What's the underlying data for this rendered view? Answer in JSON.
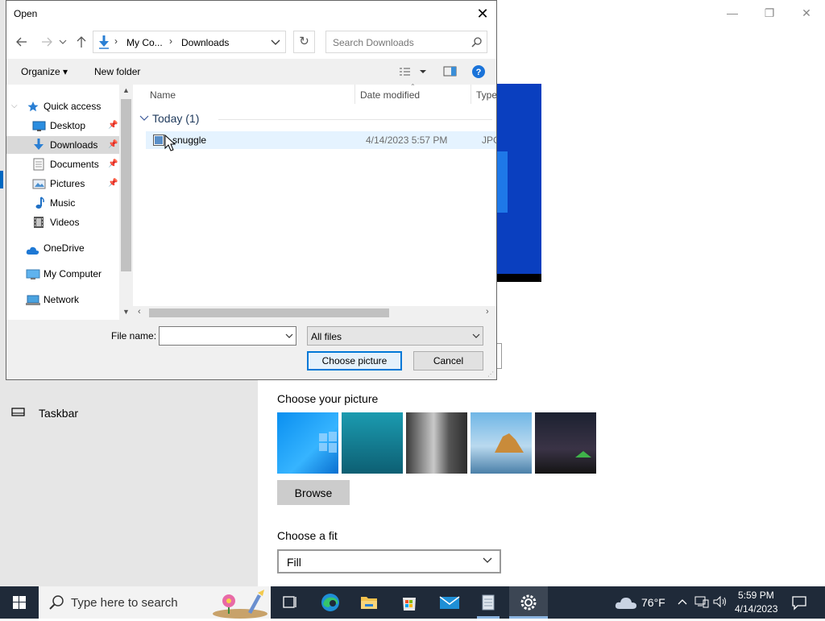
{
  "dialog": {
    "title": "Open",
    "close_glyph": "✕",
    "address": {
      "crumb1": "My Co...",
      "crumb2": "Downloads"
    },
    "search_placeholder": "Search Downloads",
    "toolbar": {
      "organize": "Organize",
      "new_folder": "New folder"
    },
    "nav": {
      "quick_access": "Quick access",
      "items": [
        {
          "label": "Desktop",
          "icon": "desktop-icon",
          "pinned": true
        },
        {
          "label": "Downloads",
          "icon": "downloads-icon",
          "pinned": true,
          "selected": true
        },
        {
          "label": "Documents",
          "icon": "documents-icon",
          "pinned": true
        },
        {
          "label": "Pictures",
          "icon": "pictures-icon",
          "pinned": true
        },
        {
          "label": "Music",
          "icon": "music-icon",
          "pinned": false
        },
        {
          "label": "Videos",
          "icon": "videos-icon",
          "pinned": false
        }
      ],
      "onedrive": "OneDrive",
      "my_computer": "My Computer",
      "network": "Network"
    },
    "columns": {
      "name": "Name",
      "date": "Date modified",
      "type": "Type"
    },
    "group": "Today (1)",
    "files": [
      {
        "name": "snuggle",
        "date": "4/14/2023 5:57 PM",
        "type": "JPG F"
      }
    ],
    "file_name_label": "File name:",
    "file_name_value": "",
    "file_type": "All files",
    "choose_label": "Choose picture",
    "cancel_label": "Cancel"
  },
  "settings": {
    "nav_taskbar": "Taskbar",
    "choose_picture_heading": "Choose your picture",
    "browse_label": "Browse",
    "choose_fit_heading": "Choose a fit",
    "fit_value": "Fill"
  },
  "taskbar": {
    "search_placeholder": "Type here to search",
    "weather": "76°F",
    "time": "5:59 PM",
    "date": "4/14/2023"
  },
  "colors": {
    "accent": "#0078d7",
    "taskbar": "#1f2a39",
    "selection": "#cce8ff"
  }
}
